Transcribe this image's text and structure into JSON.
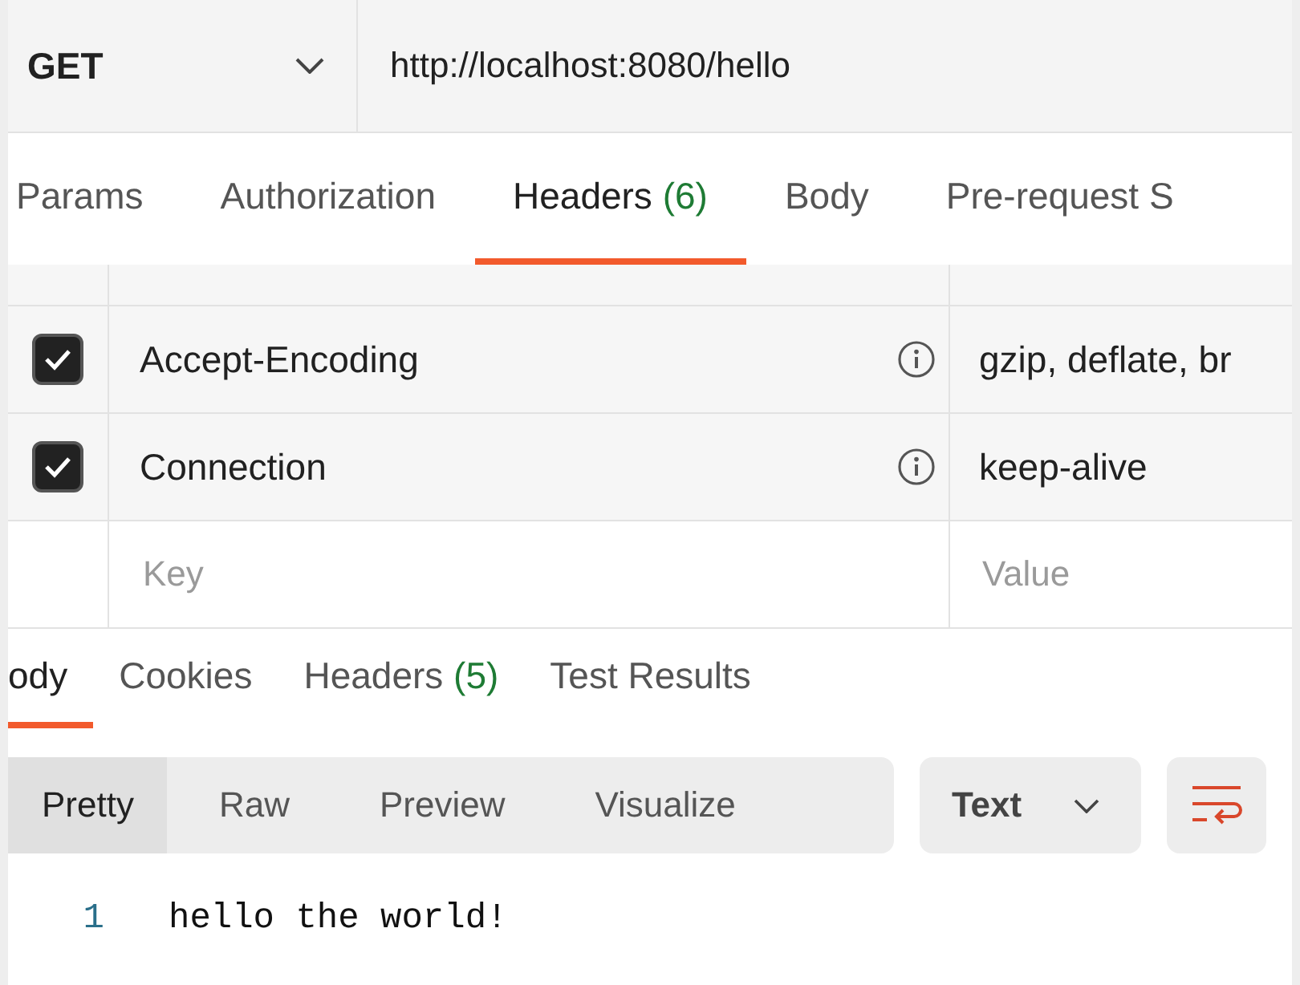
{
  "request": {
    "method": "GET",
    "url": "http://localhost:8080/hello"
  },
  "request_tabs": [
    {
      "label": "Params",
      "selected": false
    },
    {
      "label": "Authorization",
      "selected": false
    },
    {
      "label": "Headers",
      "count": "(6)",
      "selected": true
    },
    {
      "label": "Body",
      "selected": false
    },
    {
      "label": "Pre-request S",
      "selected": false
    }
  ],
  "headers": [
    {
      "key": "Accept-Encoding",
      "value": "gzip, deflate, br",
      "checked": true
    },
    {
      "key": "Connection",
      "value": "keep-alive",
      "checked": true
    }
  ],
  "new_header": {
    "key_placeholder": "Key",
    "value_placeholder": "Value"
  },
  "response_tabs": [
    {
      "label": "ody",
      "selected": true
    },
    {
      "label": "Cookies",
      "selected": false
    },
    {
      "label": "Headers",
      "count": "(5)",
      "selected": false
    },
    {
      "label": "Test Results",
      "selected": false
    }
  ],
  "view_modes": [
    {
      "label": "Pretty",
      "selected": true
    },
    {
      "label": "Raw",
      "selected": false
    },
    {
      "label": "Preview",
      "selected": false
    },
    {
      "label": "Visualize",
      "selected": false
    }
  ],
  "format": "Text",
  "code_lines": [
    {
      "number": "1",
      "text": "hello the world!"
    }
  ]
}
